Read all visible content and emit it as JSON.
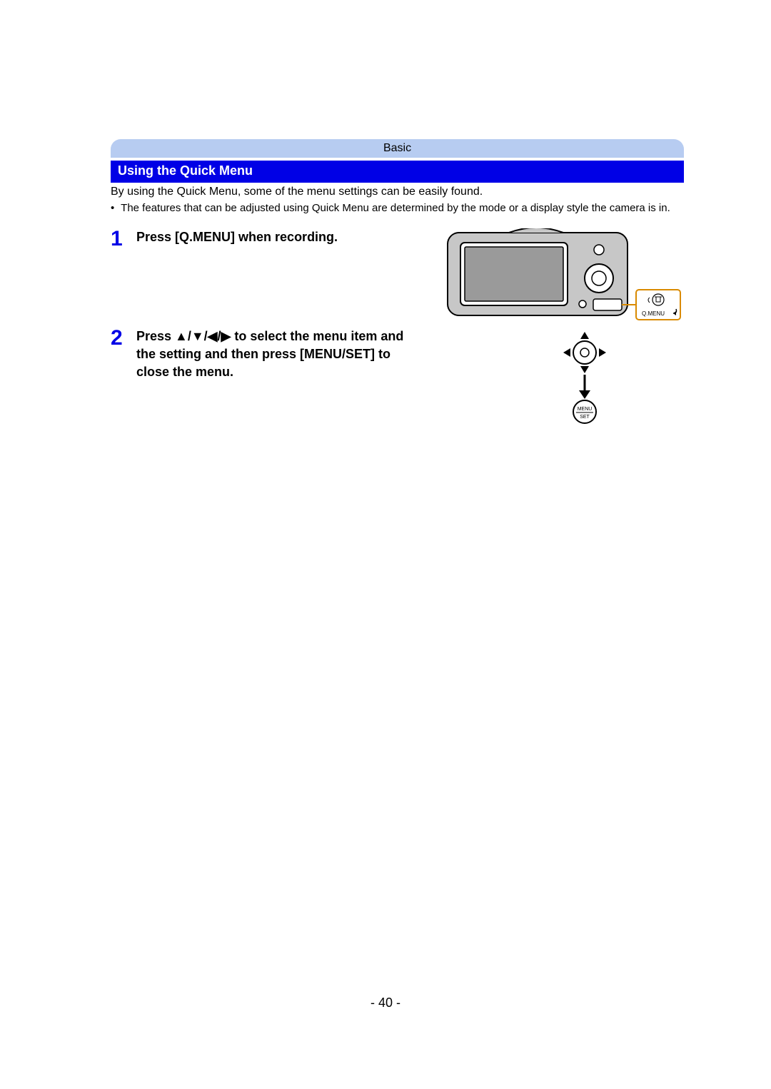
{
  "header": {
    "category": "Basic"
  },
  "title": "Using the Quick Menu",
  "intro": "By using the Quick Menu, some of the menu settings can be easily found.",
  "note_bullet": "•",
  "note": "The features that can be adjusted using Quick Menu are determined by the mode or a display style the camera is in.",
  "steps": [
    {
      "num": "1",
      "text_before": "Press [Q.MENU] when recording."
    },
    {
      "num": "2",
      "text_prefix": "Press ",
      "arrows": "▲/▼/◀/▶",
      "text_suffix": " to select the menu item and the setting and then press [MENU/SET] to close the menu."
    }
  ],
  "buttons": {
    "qmenu_label": "Q.MENU",
    "menu_set_top": "MENU",
    "menu_set_bottom": "SET"
  },
  "page_number": "- 40 -"
}
